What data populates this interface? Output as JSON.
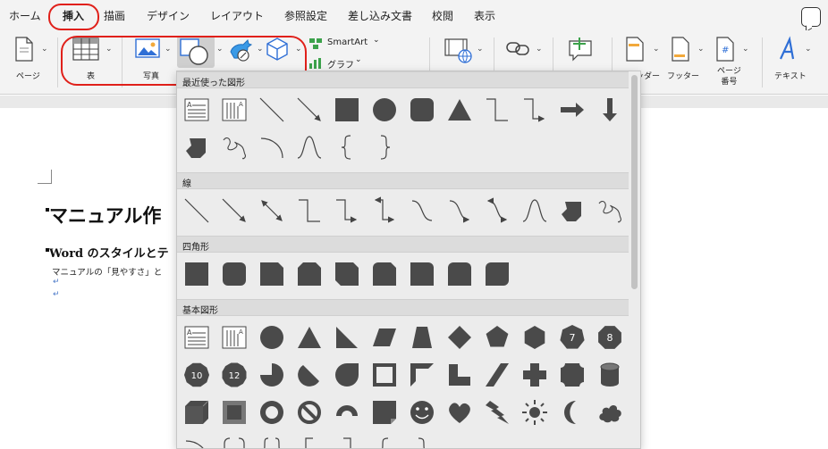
{
  "tabs": [
    {
      "label": "ホーム",
      "active": false
    },
    {
      "label": "挿入",
      "active": true
    },
    {
      "label": "描画",
      "active": false
    },
    {
      "label": "デザイン",
      "active": false
    },
    {
      "label": "レイアウト",
      "active": false
    },
    {
      "label": "参照設定",
      "active": false
    },
    {
      "label": "差し込み文書",
      "active": false
    },
    {
      "label": "校閲",
      "active": false
    },
    {
      "label": "表示",
      "active": false
    }
  ],
  "ribbon": {
    "page_label": "ページ",
    "table_label": "表",
    "photo_label": "写真",
    "smartart_label": "SmartArt",
    "graph_label": "グラフ",
    "header_label": "ヘッダー",
    "footer_label": "フッター",
    "page_number_label": "ページ\n番号",
    "textbox_label": "テキスト"
  },
  "document": {
    "heading1": "マニュアル作",
    "heading2": "Word のスタイルとテ",
    "paragraph": "マニュアルの「見やすさ」と",
    "pilcrow": "↵"
  },
  "shapes_panel": {
    "sections": [
      {
        "title": "最近使った図形",
        "shapes": [
          "text-box",
          "vertical-text-box",
          "line",
          "arrow",
          "rectangle",
          "oval",
          "rounded-rectangle",
          "triangle",
          "elbow-connector",
          "elbow-arrow-connector",
          "right-arrow",
          "down-arrow",
          "freeform",
          "scribble",
          "arc",
          "curve",
          "left-brace",
          "right-brace"
        ]
      },
      {
        "title": "線",
        "shapes": [
          "line",
          "arrow",
          "double-arrow",
          "elbow-connector",
          "elbow-arrow-connector",
          "elbow-double-arrow-connector",
          "curved-connector",
          "curved-arrow-connector",
          "curved-double-arrow-connector",
          "curve",
          "freeform",
          "scribble"
        ]
      },
      {
        "title": "四角形",
        "shapes": [
          "rectangle",
          "rounded-rectangle",
          "snip-single-corner-rectangle",
          "snip-same-side-corner-rectangle",
          "snip-diagonal-corner-rectangle",
          "snip-and-round-single-corner-rectangle",
          "round-single-corner-rectangle",
          "round-same-side-corner-rectangle",
          "round-diagonal-corner-rectangle"
        ]
      },
      {
        "title": "基本図形",
        "shapes": [
          "text-box",
          "vertical-text-box",
          "oval",
          "triangle",
          "right-triangle",
          "parallelogram",
          "trapezoid",
          "diamond",
          "pentagon",
          "hexagon",
          "heptagon",
          "octagon",
          "decagon",
          "dodecagon",
          "pie",
          "chord",
          "teardrop",
          "frame",
          "half-frame",
          "l-shape",
          "diagonal-stripe",
          "plus",
          "plaque",
          "can",
          "cube",
          "bevel",
          "donut",
          "no-symbol",
          "block-arc",
          "folded-corner",
          "smiley-face",
          "heart",
          "lightning-bolt",
          "sun",
          "moon",
          "cloud",
          "arc",
          "double-bracket",
          "double-brace",
          "left-bracket",
          "right-bracket",
          "left-brace",
          "right-brace"
        ]
      }
    ],
    "badge_numbers": {
      "heptagon": "7",
      "octagon": "8",
      "decagon": "10",
      "dodecagon": "12"
    }
  }
}
